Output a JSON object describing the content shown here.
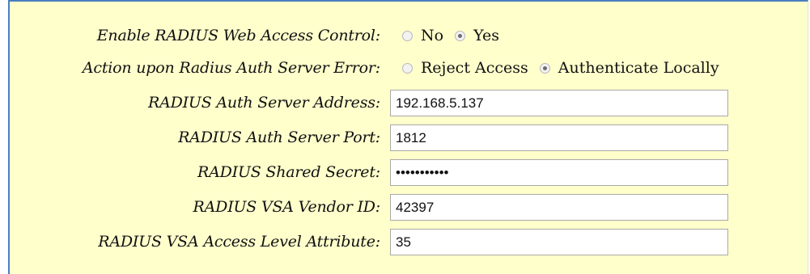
{
  "form": {
    "enable_web_access": {
      "label": "Enable RADIUS Web Access Control:",
      "options": [
        {
          "label": "No",
          "checked": false
        },
        {
          "label": "Yes",
          "checked": true
        }
      ]
    },
    "auth_server_error": {
      "label": "Action upon Radius Auth Server Error:",
      "options": [
        {
          "label": "Reject Access",
          "checked": false
        },
        {
          "label": "Authenticate Locally",
          "checked": true
        }
      ]
    },
    "server_address": {
      "label": "RADIUS Auth Server Address:",
      "value": "192.168.5.137"
    },
    "server_port": {
      "label": "RADIUS Auth Server Port:",
      "value": "1812"
    },
    "shared_secret": {
      "label": "RADIUS Shared Secret:",
      "value": "secretvalue"
    },
    "vsa_vendor_id": {
      "label": "RADIUS VSA Vendor ID:",
      "value": "42397"
    },
    "vsa_access_level": {
      "label": "RADIUS VSA Access Level Attribute:",
      "value": "35"
    }
  },
  "colors": {
    "panel_background": "#ffffcc",
    "panel_border": "#4a7fbf"
  }
}
